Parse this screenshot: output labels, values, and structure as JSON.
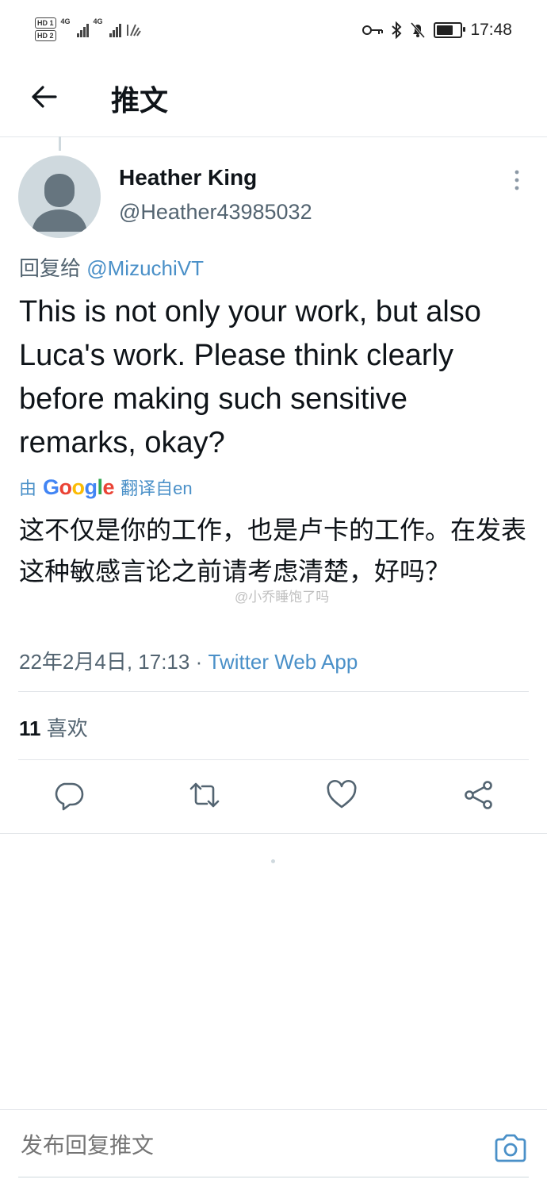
{
  "status_bar": {
    "hd_1": "HD 1",
    "hd_2": "HD 2",
    "net_1": "4G",
    "net_2": "4G",
    "time": "17:48"
  },
  "header": {
    "title": "推文"
  },
  "tweet": {
    "author_name": "Heather King",
    "author_handle": "@Heather43985032",
    "reply_prefix": "回复给",
    "reply_mention": "@MizuchiVT",
    "text": "This is not only your work, but also Luca's work. Please think clearly before making such sensitive remarks, okay?",
    "translated_prefix": "由",
    "translated_brand": "Google",
    "translated_suffix": "翻译自en",
    "translation": "这不仅是你的工作，也是卢卡的工作。在发表这种敏感言论之前请考虑清楚，好吗？",
    "watermark": "@小乔睡饱了吗",
    "date": "22年2月4日, 17:13 · ",
    "source_app": "Twitter Web App",
    "likes_count": "11",
    "likes_label": "喜欢"
  },
  "compose": {
    "placeholder": "发布回复推文"
  },
  "colors": {
    "link": "#4a90c8",
    "secondary_text": "#536471",
    "divider": "#e3e6ea"
  }
}
